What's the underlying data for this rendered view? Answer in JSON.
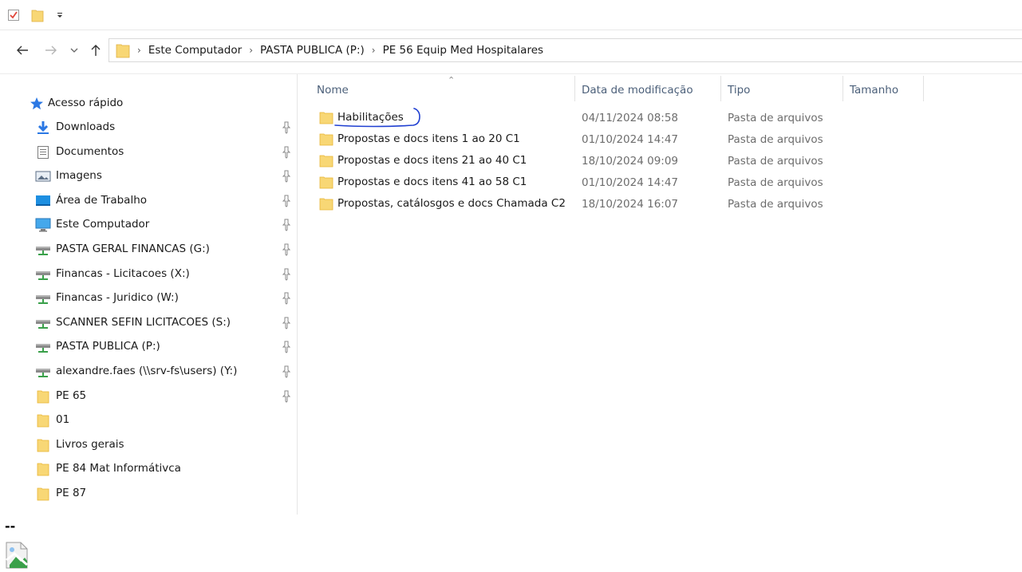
{
  "toolbar": {
    "icons": [
      "properties-icon",
      "new-folder-icon",
      "customize-dropdown-icon"
    ]
  },
  "nav_buttons": [
    "back-arrow-icon",
    "forward-arrow-icon",
    "recent-dropdown-icon",
    "up-arrow-icon"
  ],
  "address": {
    "breadcrumbs": [
      "Este Computador",
      "PASTA PUBLICA (P:)",
      "PE 56 Equip Med Hospitalares"
    ]
  },
  "navpane": {
    "quick_access_label": "Acesso rápido",
    "items": [
      {
        "label": "Downloads",
        "icon": "download-arrow-icon",
        "pinned": true
      },
      {
        "label": "Documentos",
        "icon": "document-icon",
        "pinned": true
      },
      {
        "label": "Imagens",
        "icon": "pictures-icon",
        "pinned": true
      },
      {
        "label": "Área de Trabalho",
        "icon": "desktop-icon",
        "pinned": true
      },
      {
        "label": "Este Computador",
        "icon": "computer-icon",
        "pinned": true
      },
      {
        "label": "PASTA GERAL FINANCAS (G:)",
        "icon": "network-drive-icon",
        "pinned": true
      },
      {
        "label": "Financas - Licitacoes (X:)",
        "icon": "network-drive-icon",
        "pinned": true
      },
      {
        "label": "Financas - Juridico (W:)",
        "icon": "network-drive-icon",
        "pinned": true
      },
      {
        "label": "SCANNER SEFIN LICITACOES (S:)",
        "icon": "network-drive-icon",
        "pinned": true
      },
      {
        "label": "PASTA PUBLICA (P:)",
        "icon": "network-drive-icon",
        "pinned": true
      },
      {
        "label": "alexandre.faes (\\\\srv-fs\\users) (Y:)",
        "icon": "network-drive-icon",
        "pinned": true
      },
      {
        "label": "PE 65",
        "icon": "folder-icon",
        "pinned": true
      },
      {
        "label": "01",
        "icon": "folder-icon",
        "pinned": false
      },
      {
        "label": "Livros gerais",
        "icon": "folder-icon",
        "pinned": false
      },
      {
        "label": "PE 84 Mat Informátivca",
        "icon": "folder-icon",
        "pinned": false
      },
      {
        "label": "PE 87",
        "icon": "folder-icon",
        "pinned": false
      }
    ]
  },
  "list": {
    "columns": [
      "Nome",
      "Data de modificação",
      "Tipo",
      "Tamanho"
    ],
    "rows": [
      {
        "name": "Habilitações",
        "date": "04/11/2024 08:58",
        "type": "Pasta de arquivos",
        "annotated": true
      },
      {
        "name": "Propostas e docs itens 1 ao 20 C1",
        "date": "01/10/2024 14:47",
        "type": "Pasta de arquivos"
      },
      {
        "name": "Propostas e docs itens 21 ao 40 C1",
        "date": "18/10/2024 09:09",
        "type": "Pasta de arquivos"
      },
      {
        "name": "Propostas e docs itens 41 ao 58 C1",
        "date": "01/10/2024 14:47",
        "type": "Pasta de arquivos"
      },
      {
        "name": "Propostas, catálosgos e docs Chamada C2",
        "date": "18/10/2024 16:07",
        "type": "Pasta de arquivos"
      }
    ]
  },
  "footer": {
    "dashes": "--"
  },
  "colors": {
    "folder": "#f8d775",
    "folder_dark": "#e8b535",
    "accent_blue": "#2b78e4",
    "annotation": "#1f3fd1",
    "header_text": "#4c607a"
  }
}
